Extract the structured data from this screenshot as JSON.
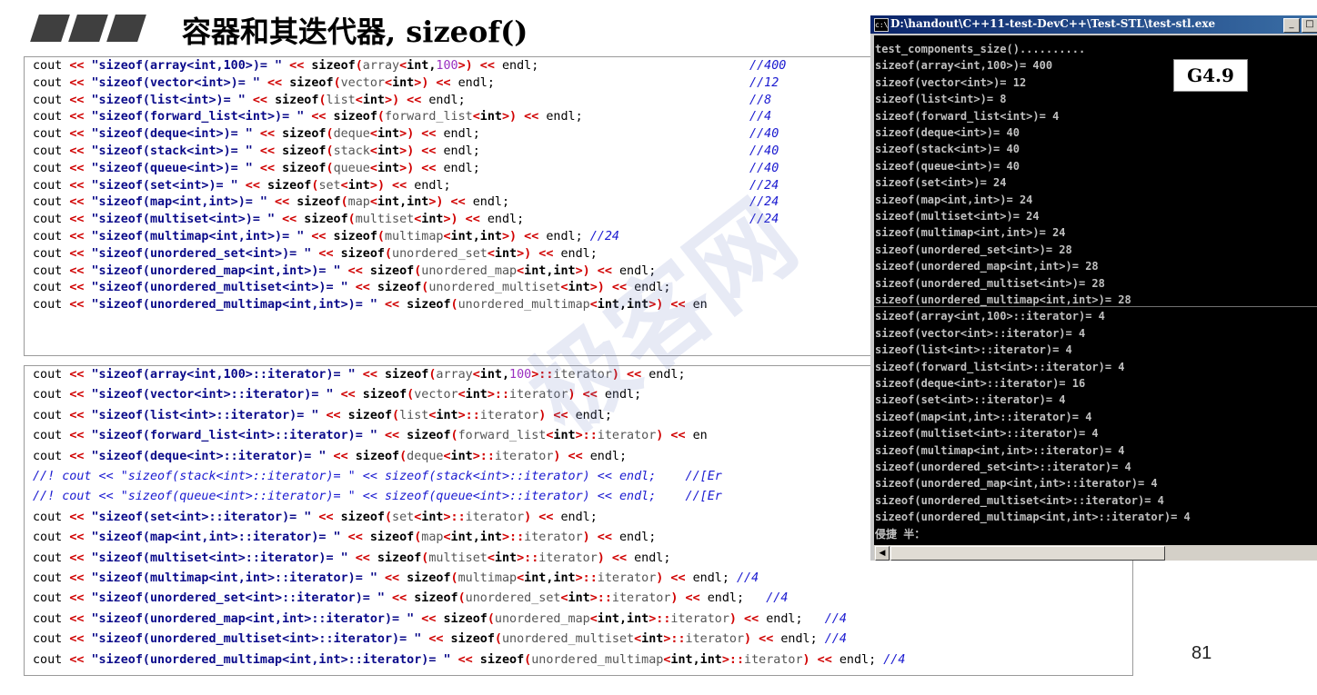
{
  "slide": {
    "title": "容器和其迭代器, sizeof()",
    "page_number": "81"
  },
  "console": {
    "title": "D:\\handout\\C++11-test-DevC++\\Test-STL\\test-stl.exe",
    "min_button": "_",
    "close_button": "□",
    "badge": "G4.9",
    "lines": [
      "test_components_size()..........",
      "sizeof(array<int,100>)= 400",
      "sizeof(vector<int>)= 12",
      "sizeof(list<int>)= 8",
      "sizeof(forward_list<int>)= 4",
      "sizeof(deque<int>)= 40",
      "sizeof(stack<int>)= 40",
      "sizeof(queue<int>)= 40",
      "sizeof(set<int>)= 24",
      "sizeof(map<int,int>)= 24",
      "sizeof(multiset<int>)= 24",
      "sizeof(multimap<int,int>)= 24",
      "sizeof(unordered_set<int>)= 28",
      "sizeof(unordered_map<int,int>)= 28",
      "sizeof(unordered_multiset<int>)= 28",
      "sizeof(unordered_multimap<int,int>)= 28",
      "sizeof(array<int,100>::iterator)= 4",
      "sizeof(vector<int>::iterator)= 4",
      "sizeof(list<int>::iterator)= 4",
      "sizeof(forward_list<int>::iterator)= 4",
      "sizeof(deque<int>::iterator)= 16",
      "sizeof(set<int>::iterator)= 4",
      "sizeof(map<int,int>::iterator)= 4",
      "sizeof(multiset<int>::iterator)= 4",
      "sizeof(multimap<int,int>::iterator)= 4",
      "sizeof(unordered_set<int>::iterator)= 4",
      "sizeof(unordered_map<int,int>::iterator)= 4",
      "sizeof(unordered_multiset<int>::iterator)= 4",
      "sizeof(unordered_multimap<int,int>::iterator)= 4",
      "侵捷 半："
    ]
  },
  "code_box_1": {
    "lines": [
      {
        "label": "sizeof(array<int,100>)= ",
        "type": "array",
        "targ": "int,100",
        "tail": "",
        "comment": "//400",
        "cpos": 110
      },
      {
        "label": "sizeof(vector<int>)= ",
        "type": "vector",
        "targ": "int",
        "tail": "",
        "comment": "//12",
        "cpos": 110
      },
      {
        "label": "sizeof(list<int>)= ",
        "type": "list",
        "targ": "int",
        "tail": "",
        "comment": "//8",
        "cpos": 110
      },
      {
        "label": "sizeof(forward_list<int>)= ",
        "type": "forward_list",
        "targ": "int",
        "tail": "",
        "comment": "//4",
        "cpos": 100
      },
      {
        "label": "sizeof(deque<int>)= ",
        "type": "deque",
        "targ": "int",
        "tail": "",
        "comment": "//40",
        "cpos": 110
      },
      {
        "label": "sizeof(stack<int>)= ",
        "type": "stack",
        "targ": "int",
        "tail": "",
        "comment": "//40",
        "cpos": 110
      },
      {
        "label": "sizeof(queue<int>)= ",
        "type": "queue",
        "targ": "int",
        "tail": "",
        "comment": "//40",
        "cpos": 110
      },
      {
        "label": "sizeof(set<int>)= ",
        "type": "set",
        "targ": "int",
        "tail": "",
        "comment": "//24",
        "cpos": 110
      },
      {
        "label": "sizeof(map<int,int>)= ",
        "type": "map",
        "targ": "int,int",
        "tail": "",
        "comment": "//24",
        "cpos": 110
      },
      {
        "label": "sizeof(multiset<int>)= ",
        "type": "multiset",
        "targ": "int",
        "tail": "",
        "comment": "//24",
        "cpos": 110
      },
      {
        "label": "sizeof(multimap<int,int>)= ",
        "type": "multimap",
        "targ": "int,int",
        "tail": "",
        "comment": "//24",
        "cpos": 0
      },
      {
        "label": "sizeof(unordered_set<int>)= ",
        "type": "unordered_set",
        "targ": "int",
        "tail": "",
        "comment": "",
        "cpos": 0
      },
      {
        "label": "sizeof(unordered_map<int,int>)= ",
        "type": "unordered_map",
        "targ": "int,int",
        "tail": "",
        "comment": "",
        "cpos": 0
      },
      {
        "label": "sizeof(unordered_multiset<int>)= ",
        "type": "unordered_multiset",
        "targ": "int",
        "tail": "",
        "comment": "",
        "cpos": 0
      },
      {
        "label": "sizeof(unordered_multimap<int,int>)= ",
        "type": "unordered_multimap",
        "targ": "int,int",
        "tail": "",
        "comment": "",
        "cpos": 0,
        "cut": true
      }
    ]
  },
  "code_box_2": {
    "lines": [
      {
        "label": "sizeof(array<int,100>::iterator)= ",
        "type": "array",
        "targ": "int,100",
        "tail": "::iterator",
        "comment": ""
      },
      {
        "label": "sizeof(vector<int>::iterator)= ",
        "type": "vector",
        "targ": "int",
        "tail": "::iterator",
        "comment": ""
      },
      {
        "label": "sizeof(list<int>::iterator)= ",
        "type": "list",
        "targ": "int",
        "tail": "::iterator",
        "comment": ""
      },
      {
        "label": "sizeof(forward_list<int>::iterator)= ",
        "type": "forward_list",
        "targ": "int",
        "tail": "::iterator",
        "comment": "",
        "cut": true
      },
      {
        "label": "sizeof(deque<int>::iterator)= ",
        "type": "deque",
        "targ": "int",
        "tail": "::iterator",
        "comment": ""
      },
      {
        "disabled": "//! cout << \"sizeof(stack<int>::iterator)= \" << sizeof(stack<int>::iterator) << endl;    //[Er"
      },
      {
        "disabled": "//! cout << \"sizeof(queue<int>::iterator)= \" << sizeof(queue<int>::iterator) << endl;    //[Er"
      },
      {
        "label": "sizeof(set<int>::iterator)= ",
        "type": "set",
        "targ": "int",
        "tail": "::iterator",
        "comment": ""
      },
      {
        "label": "sizeof(map<int,int>::iterator)= ",
        "type": "map",
        "targ": "int,int",
        "tail": "::iterator",
        "comment": ""
      },
      {
        "label": "sizeof(multiset<int>::iterator)= ",
        "type": "multiset",
        "targ": "int",
        "tail": "::iterator",
        "comment": ""
      },
      {
        "label": "sizeof(multimap<int,int>::iterator)= ",
        "type": "multimap",
        "targ": "int,int",
        "tail": "::iterator",
        "comment": "//4"
      },
      {
        "label": "sizeof(unordered_set<int>::iterator)= ",
        "type": "unordered_set",
        "targ": "int",
        "tail": "::iterator",
        "comment": "  //4"
      },
      {
        "label": "sizeof(unordered_map<int,int>::iterator)= ",
        "type": "unordered_map",
        "targ": "int,int",
        "tail": "::iterator",
        "comment": "  //4"
      },
      {
        "label": "sizeof(unordered_multiset<int>::iterator)= ",
        "type": "unordered_multiset",
        "targ": "int",
        "tail": "::iterator",
        "comment": "//4"
      },
      {
        "label": "sizeof(unordered_multimap<int,int>::iterator)= ",
        "type": "unordered_multimap",
        "targ": "int,int",
        "tail": "::iterator",
        "comment": "//4"
      }
    ]
  },
  "code_tokens": {
    "cout": "cout",
    "shift": "<<",
    "sizeof": "sizeof",
    "endl": "endl;",
    "cut_endl": "en"
  }
}
